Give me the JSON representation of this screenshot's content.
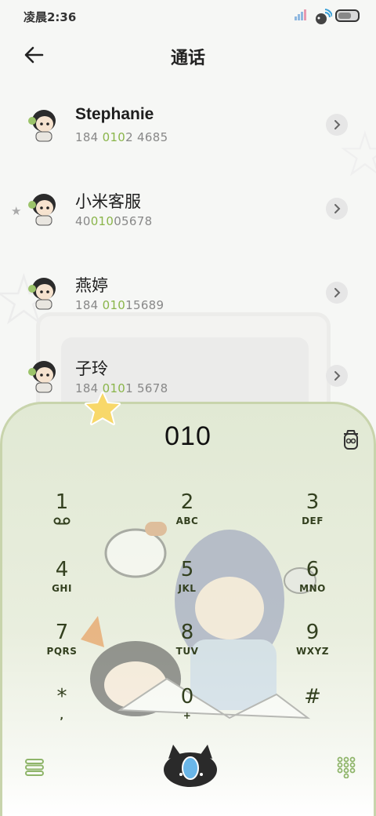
{
  "status_bar": {
    "time": "凌晨2:36"
  },
  "header": {
    "title": "通话"
  },
  "contacts": [
    {
      "name": "Stephanie",
      "num_pre": "184 ",
      "num_hl": "010",
      "num_post": "2 4685",
      "favorite": false
    },
    {
      "name": "小米客服",
      "num_pre": "40",
      "num_hl": "010",
      "num_post": "05678",
      "favorite": true
    },
    {
      "name": "燕婷",
      "num_pre": "184 ",
      "num_hl": "010",
      "num_post": "15689",
      "favorite": false
    },
    {
      "name": "子玲",
      "num_pre": "184 ",
      "num_hl": "010",
      "num_post": "1 5678",
      "favorite": false
    }
  ],
  "dialpad": {
    "number": "010",
    "keys": [
      {
        "digit": "1",
        "letters": ""
      },
      {
        "digit": "2",
        "letters": "ABC"
      },
      {
        "digit": "3",
        "letters": "DEF"
      },
      {
        "digit": "4",
        "letters": "GHI"
      },
      {
        "digit": "5",
        "letters": "JKL"
      },
      {
        "digit": "6",
        "letters": "MNO"
      },
      {
        "digit": "7",
        "letters": "PQRS"
      },
      {
        "digit": "8",
        "letters": "TUV"
      },
      {
        "digit": "9",
        "letters": "WXYZ"
      },
      {
        "digit": "*",
        "letters": ","
      },
      {
        "digit": "0",
        "letters": "+"
      },
      {
        "digit": "#",
        "letters": ""
      }
    ]
  },
  "colors": {
    "accent_green": "#8ab54a",
    "panel_border": "#c8d4ac",
    "key_text": "#33401f"
  },
  "icons": {
    "back": "arrow-left-icon",
    "chevron": "chevron-right-icon",
    "favorite": "star-icon",
    "delete": "delete-icon",
    "voicemail": "voicemail-icon",
    "menu": "menu-icon",
    "call": "call-icon",
    "keypad": "keypad-icon"
  }
}
